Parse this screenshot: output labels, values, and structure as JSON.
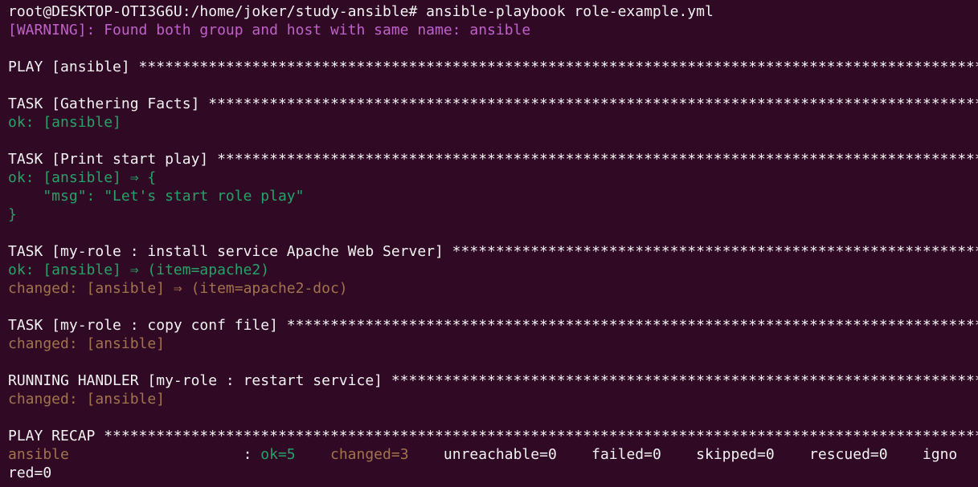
{
  "terminal": {
    "background": "#300a24",
    "colors": {
      "default": "#f2f2f2",
      "warning": "#c061cb",
      "ok": "#26a269",
      "changed": "#a2734c"
    },
    "lines": [
      [
        {
          "t": "root@DESKTOP-OTI3G6U:/home/joker/study-ansible# ansible-playbook role-example.yml",
          "c": "default"
        }
      ],
      [
        {
          "t": "[WARNING]: Found both group and host with same name: ansible",
          "c": "warning"
        }
      ],
      [],
      [
        {
          "t": "PLAY [ansible] ********************************************************************************************************",
          "c": "default"
        }
      ],
      [],
      [
        {
          "t": "TASK [Gathering Facts] ************************************************************************************************",
          "c": "default"
        }
      ],
      [
        {
          "t": "ok: [ansible]",
          "c": "ok"
        }
      ],
      [],
      [
        {
          "t": "TASK [Print start play] ***********************************************************************************************",
          "c": "default"
        }
      ],
      [
        {
          "t": "ok: [ansible] ⇒ {",
          "c": "ok"
        }
      ],
      [
        {
          "t": "    \"msg\": \"Let's start role play\"",
          "c": "ok"
        }
      ],
      [
        {
          "t": "}",
          "c": "ok"
        }
      ],
      [],
      [
        {
          "t": "TASK [my-role : install service Apache Web Server] ********************************************************************",
          "c": "default"
        }
      ],
      [
        {
          "t": "ok: [ansible] ⇒ (item=apache2)",
          "c": "ok"
        }
      ],
      [
        {
          "t": "changed: [ansible] ⇒ (item=apache2-doc)",
          "c": "changed"
        }
      ],
      [],
      [
        {
          "t": "TASK [my-role : copy conf file] ***************************************************************************************",
          "c": "default"
        }
      ],
      [
        {
          "t": "changed: [ansible]",
          "c": "changed"
        }
      ],
      [],
      [
        {
          "t": "RUNNING HANDLER [my-role : restart service] ***************************************************************************",
          "c": "default"
        }
      ],
      [
        {
          "t": "changed: [ansible]",
          "c": "changed"
        }
      ],
      [],
      [
        {
          "t": "PLAY RECAP ************************************************************************************************************",
          "c": "default"
        }
      ],
      [
        {
          "t": "ansible",
          "c": "changed"
        },
        {
          "t": "                    : ",
          "c": "default"
        },
        {
          "t": "ok=5",
          "c": "ok"
        },
        {
          "t": "    ",
          "c": "default"
        },
        {
          "t": "changed=3",
          "c": "changed"
        },
        {
          "t": "    unreachable=0    failed=0    skipped=0    rescued=0    igno",
          "c": "default"
        }
      ],
      [
        {
          "t": "red=0",
          "c": "default"
        }
      ]
    ]
  }
}
